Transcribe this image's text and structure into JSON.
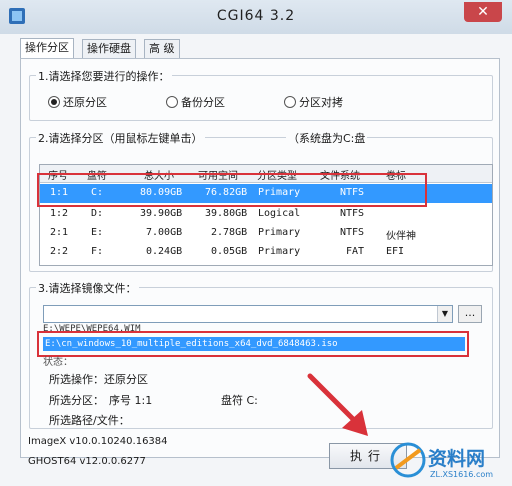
{
  "window": {
    "title": "CGI64  3.2",
    "close_glyph": "✕"
  },
  "tabs": [
    {
      "label": "操作分区",
      "active": true
    },
    {
      "label": "操作硬盘",
      "active": false
    },
    {
      "label": "高 级",
      "active": false
    }
  ],
  "operation": {
    "label": "1.请选择您要进行的操作：",
    "options": [
      {
        "label": "还原分区",
        "selected": true
      },
      {
        "label": "备份分区",
        "selected": false
      },
      {
        "label": "分区对拷",
        "selected": false
      }
    ]
  },
  "partition": {
    "label": "2.请选择分区（用鼠标左键单击）",
    "system_disk_note": "（系统盘为C:盘",
    "columns": [
      "序号",
      "盘符",
      "总大小",
      "可用空间",
      "分区类型",
      "文件系统",
      "卷标"
    ],
    "rows": [
      {
        "no": "1:1",
        "drive": "C:",
        "total": "80.09GB",
        "free": "76.82GB",
        "type": "Primary",
        "fs": "NTFS",
        "label": ""
      },
      {
        "no": "1:2",
        "drive": "D:",
        "total": "39.90GB",
        "free": "39.80GB",
        "type": "Logical",
        "fs": "NTFS",
        "label": ""
      },
      {
        "no": "2:1",
        "drive": "E:",
        "total": "7.00GB",
        "free": "2.78GB",
        "type": "Primary",
        "fs": "NTFS",
        "label": "伙伴神"
      },
      {
        "no": "2:2",
        "drive": "F:",
        "total": "0.24GB",
        "free": "0.05GB",
        "type": "Primary",
        "fs": "FAT",
        "label": "EFI"
      }
    ]
  },
  "image": {
    "label": "3.请选择镜像文件：",
    "input_value": "",
    "browse_label": "...",
    "dropdown_path": "E:\\WEPE\\WEPE64.WIM",
    "iso_item": "E:\\cn_windows_10_multiple_editions_x64_dvd_6848463.iso",
    "status_header": "状态：",
    "selected_operation": "所选操作：还原分区",
    "selected_partition_label": "所选分区：",
    "selected_partition_no": "序号 1:1",
    "selected_partition_drive": "盘符 C:",
    "selected_path": "所选路径/文件："
  },
  "versions": {
    "imagex": "ImageX v10.0.10240.16384",
    "ghost": "GHOST64 v12.0.0.6277"
  },
  "execute_label": "执行",
  "watermark": {
    "text": "资料网",
    "url": "ZL.XS1616.com"
  },
  "colors": {
    "selection": "#3399ff",
    "annotation": "#d9323a",
    "close": "#c9464a"
  }
}
